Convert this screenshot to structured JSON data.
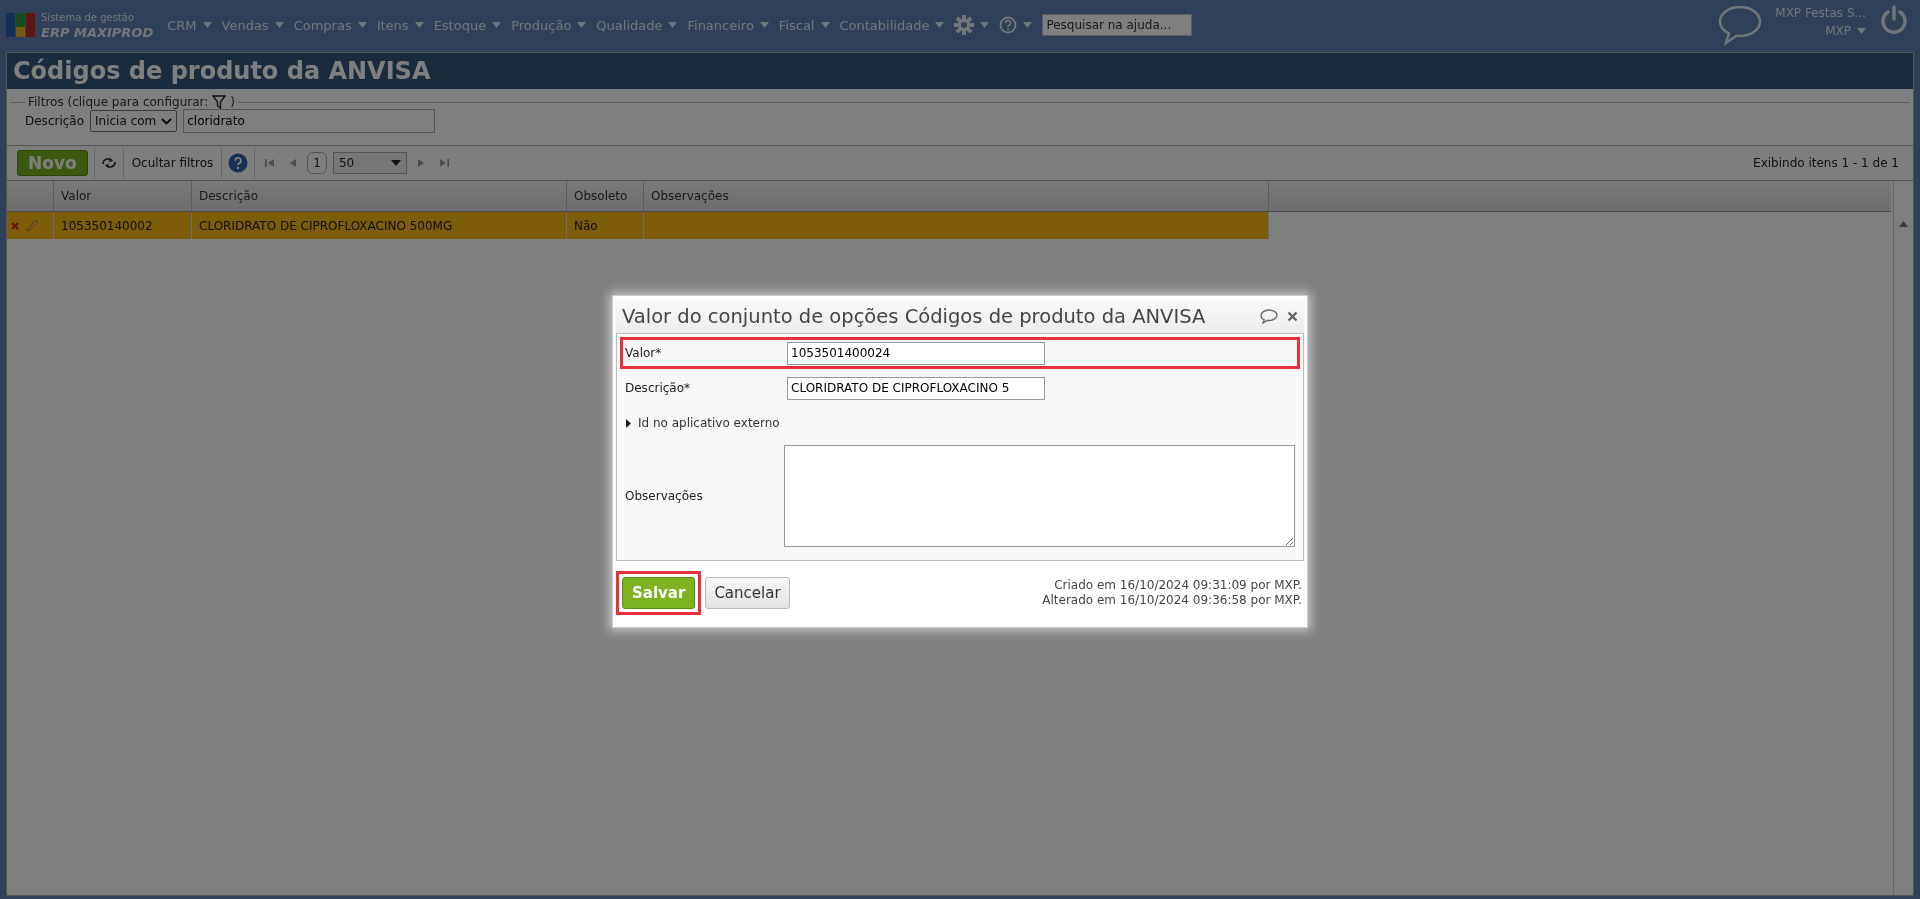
{
  "top_bar": {
    "logo": {
      "line_1": "Sistema de gestão",
      "line_2": "ERP MAXIPROD"
    },
    "menus": [
      {
        "label": "CRM"
      },
      {
        "label": "Vendas"
      },
      {
        "label": "Compras"
      },
      {
        "label": "Itens"
      },
      {
        "label": "Estoque"
      },
      {
        "label": "Produção"
      },
      {
        "label": "Qualidade"
      },
      {
        "label": "Financeiro"
      },
      {
        "label": "Fiscal"
      },
      {
        "label": "Contabilidade"
      }
    ],
    "help_search": {
      "placeholder": "Pesquisar na ajuda..."
    },
    "user": {
      "company": "MXP Festas S...",
      "name": "MXP"
    }
  },
  "page": {
    "title": "Códigos de produto da ANVISA",
    "filters": {
      "legend": "Filtros (clique para configurar:",
      "legend_end": ")",
      "field_label": "Descrição",
      "operator": "Inicia com",
      "value": "cloridrato"
    },
    "toolbar": {
      "new_button": "Novo",
      "hide_filters": "Ocultar filtros",
      "page": "1",
      "page_size": "50",
      "status": "Exibindo itens 1 - 1 de 1"
    },
    "table": {
      "columns": [
        "Valor",
        "Descrição",
        "Obsoleto",
        "Observações"
      ],
      "rows": [
        {
          "cells": [
            "105350140002",
            "CLORIDRATO DE CIPROFLOXACINO 500MG",
            "Não",
            null
          ],
          "selected": true
        }
      ]
    }
  },
  "dialog": {
    "title": "Valor do conjunto de opções Códigos de produto da ANVISA",
    "fields": [
      {
        "kind": "text",
        "label": "Valor*",
        "value": "1053501400024",
        "highlighted": true
      },
      {
        "kind": "text",
        "label": "Descrição*",
        "value": "CLORIDRATO DE CIPROFLOXACINO 5",
        "highlighted": false
      },
      {
        "kind": "expander",
        "label": "Id no aplicativo externo",
        "expanded": false
      },
      {
        "kind": "textarea",
        "label": "Observações"
      }
    ],
    "buttons": [
      {
        "kind": "primary",
        "label": "Salvar",
        "highlighted": true
      },
      {
        "kind": "secondary",
        "label": "Cancelar",
        "highlighted": false
      }
    ],
    "audit": [
      "Criado em 16/10/2024 09:31:09 por MXP.",
      "Alterado em 16/10/2024 09:36:58 por MXP."
    ]
  }
}
